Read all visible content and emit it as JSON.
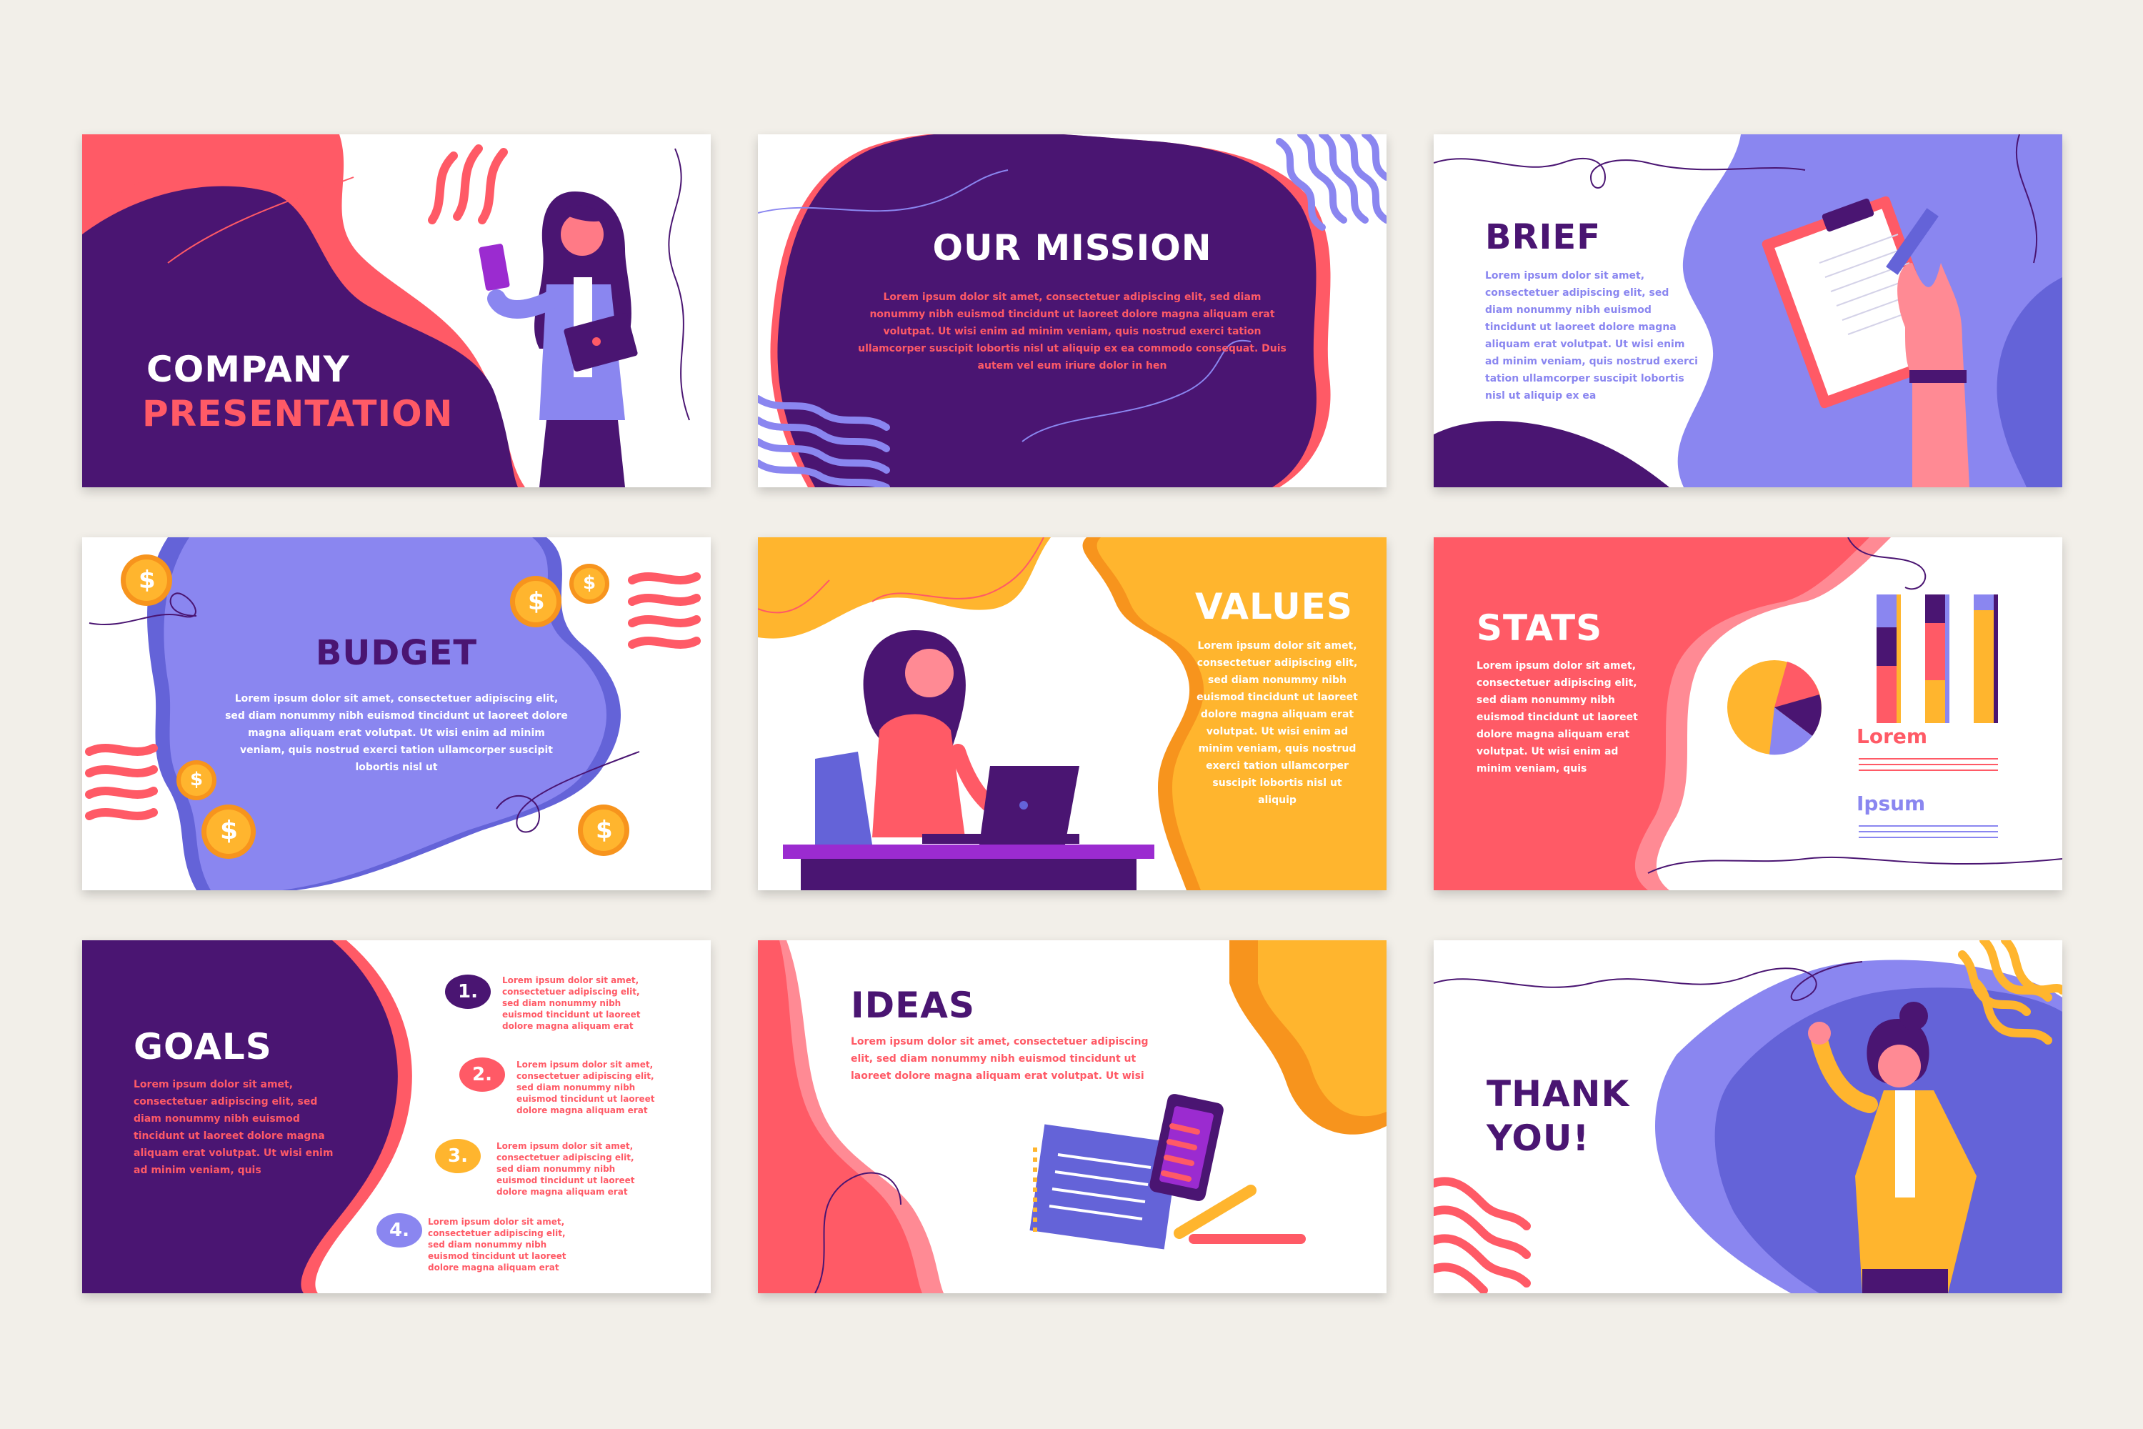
{
  "slides": {
    "cover": {
      "title_line1": "COMPANY",
      "title_line2": "PRESENTATION"
    },
    "mission": {
      "title": "OUR MISSION",
      "body": "Lorem ipsum dolor sit amet, consectetuer adipiscing elit, sed diam nonummy nibh euismod tincidunt ut laoreet dolore magna aliquam erat volutpat. Ut wisi enim ad minim veniam, quis nostrud exerci tation ullamcorper suscipit lobortis nisl ut aliquip ex ea commodo consequat. Duis autem vel eum iriure dolor in hen"
    },
    "brief": {
      "title": "BRIEF",
      "body": "Lorem ipsum dolor sit amet, consectetuer adipiscing elit, sed diam nonummy nibh euismod tincidunt ut laoreet dolore magna aliquam erat volutpat. Ut wisi enim ad minim veniam, quis nostrud exerci tation ullamcorper suscipit lobortis nisl ut aliquip ex ea"
    },
    "budget": {
      "title": "BUDGET",
      "body": "Lorem ipsum dolor sit amet, consectetuer adipiscing elit, sed diam nonummy nibh euismod tincidunt ut laoreet dolore magna aliquam erat volutpat. Ut wisi enim ad minim veniam, quis nostrud exerci tation ullamcorper suscipit lobortis nisl ut",
      "coin_symbol": "$"
    },
    "values": {
      "title": "VALUES",
      "body": "Lorem ipsum dolor sit amet, consectetuer adipiscing elit, sed diam nonummy nibh euismod tincidunt ut laoreet dolore magna aliquam erat volutpat. Ut wisi enim ad minim veniam, quis nostrud exerci tation ullamcorper suscipit lobortis nisl ut aliquip"
    },
    "stats": {
      "title": "STATS",
      "body": "Lorem ipsum dolor sit amet, consectetuer adipiscing elit, sed diam nonummy nibh euismod tincidunt ut laoreet dolore magna aliquam erat volutpat. Ut wisi enim ad minim veniam, quis",
      "label1": "Lorem",
      "label2": "Ipsum"
    },
    "goals": {
      "title": "GOALS",
      "body": "Lorem ipsum dolor sit amet, consectetuer adipiscing elit, sed diam nonummy nibh euismod tincidunt ut laoreet dolore magna aliquam erat volutpat. Ut wisi enim ad minim veniam, quis",
      "items": [
        {
          "num": "1.",
          "text": "Lorem ipsum dolor sit amet, consectetuer adipiscing elit, sed diam nonummy nibh euismod tincidunt ut laoreet dolore magna aliquam erat"
        },
        {
          "num": "2.",
          "text": "Lorem ipsum dolor sit amet, consectetuer adipiscing elit, sed diam nonummy nibh euismod tincidunt ut laoreet dolore magna aliquam erat"
        },
        {
          "num": "3.",
          "text": "Lorem ipsum dolor sit amet, consectetuer adipiscing elit, sed diam nonummy nibh euismod tincidunt ut laoreet dolore magna aliquam erat"
        },
        {
          "num": "4.",
          "text": "Lorem ipsum dolor sit amet, consectetuer adipiscing elit, sed diam nonummy nibh euismod tincidunt ut laoreet dolore magna aliquam erat"
        }
      ]
    },
    "ideas": {
      "title": "IDEAS",
      "body": "Lorem ipsum dolor sit amet, consectetuer adipiscing elit, sed diam nonummy nibh euismod tincidunt ut laoreet dolore magna aliquam erat volutpat. Ut wisi"
    },
    "thanks": {
      "title_line1": "THANK",
      "title_line2": "YOU!"
    }
  },
  "colors": {
    "purple": "#4a1572",
    "lavender": "#8a86f0",
    "coral": "#ff5a66",
    "yellow": "#ffb52e",
    "background": "#f2efe9"
  }
}
